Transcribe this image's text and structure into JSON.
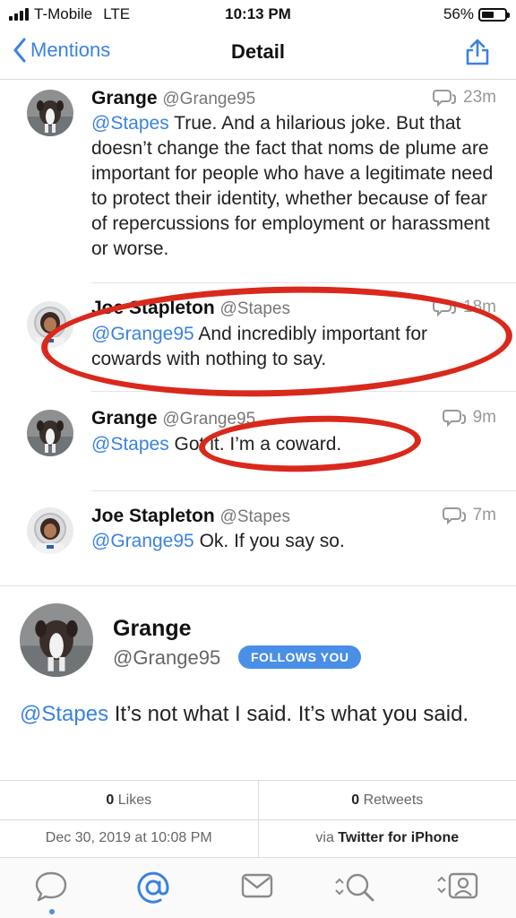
{
  "status_bar": {
    "carrier": "T-Mobile",
    "network": "LTE",
    "time": "10:13 PM",
    "battery": "56%",
    "battery_level": 0.56
  },
  "nav": {
    "back_label": "Mentions",
    "title": "Detail"
  },
  "replies": [
    {
      "name": "Grange",
      "handle": "@Grange95",
      "time": "23m",
      "mention": "@Stapes",
      "text": " True. And a hilarious joke. But that doesn’t change the fact that noms de plume are important for people who have a legitimate need to protect their identity, whether because of fear of repercussions for employment or harassment or worse."
    },
    {
      "name": "Joe Stapleton",
      "handle": "@Stapes",
      "time": "18m",
      "mention": "@Grange95",
      "text": " And incredibly important for cowards with nothing to say."
    },
    {
      "name": "Grange",
      "handle": "@Grange95",
      "time": "9m",
      "mention": "@Stapes",
      "text": " Got it. I’m a coward."
    },
    {
      "name": "Joe Stapleton",
      "handle": "@Stapes",
      "time": "7m",
      "mention": "@Grange95",
      "text": " Ok. If you say so."
    }
  ],
  "focus": {
    "name": "Grange",
    "handle": "@Grange95",
    "badge": "FOLLOWS YOU",
    "mention": "@Stapes",
    "text": " It’s not what I said. It’s what you said."
  },
  "stats": {
    "likes_count": "0",
    "likes_label": " Likes",
    "retweets_count": "0",
    "retweets_label": " Retweets"
  },
  "info": {
    "timestamp": "Dec 30, 2019 at 10:08 PM",
    "via_prefix": "via ",
    "client": "Twitter for iPhone"
  },
  "tabs": [
    "chat-bubble-icon",
    "at-sign-icon",
    "envelope-icon",
    "search-icon",
    "profile-icon"
  ],
  "colors": {
    "accent": "#3b82e0",
    "badge": "#4a8fe7",
    "annotation": "#d9291c"
  }
}
